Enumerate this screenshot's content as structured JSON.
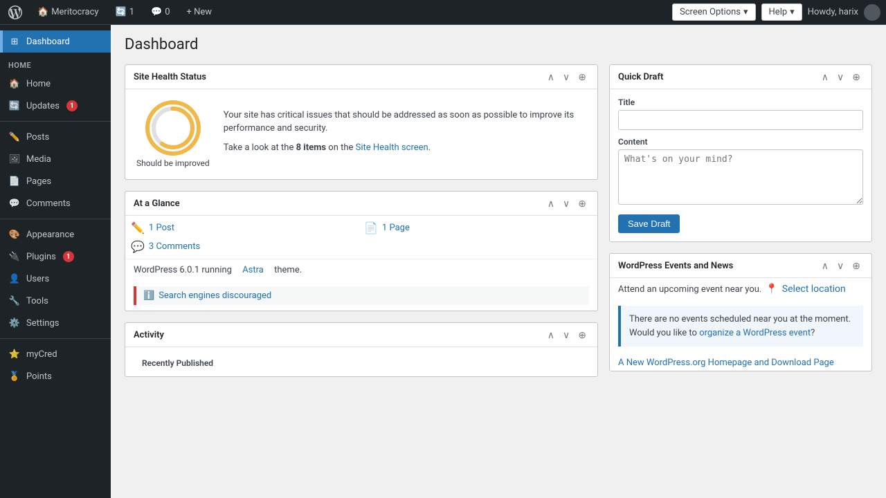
{
  "adminBar": {
    "siteName": "Meritocracy",
    "updates": "1",
    "comments": "0",
    "newLabel": "+ New",
    "howdy": "Howdy, harix",
    "screenOptions": "Screen Options",
    "screenOptionsArrow": "▾",
    "help": "Help",
    "helpArrow": "▾"
  },
  "sidebar": {
    "sectionHome": "Home",
    "home": "Home",
    "updates": "Updates",
    "updatesBadge": "1",
    "posts": "Posts",
    "media": "Media",
    "pages": "Pages",
    "comments": "Comments",
    "appearance": "Appearance",
    "plugins": "Plugins",
    "pluginsBadge": "1",
    "users": "Users",
    "tools": "Tools",
    "settings": "Settings",
    "myCred": "myCred",
    "points": "Points"
  },
  "page": {
    "title": "Dashboard"
  },
  "siteHealth": {
    "title": "Site Health Status",
    "circleLabel": "Should be improved",
    "description": "Your site has critical issues that should be addressed as soon as possible to improve its performance and security.",
    "linkText": "8 items",
    "linkLabel": "Take a look at the",
    "linkSuffix": "on the",
    "screenText": "Site Health screen",
    "fullText": "Take a look at the 8 items on the Site Health screen."
  },
  "atAGlance": {
    "title": "At a Glance",
    "post": "1 Post",
    "page": "1 Page",
    "comments": "3 Comments",
    "wpVersion": "WordPress 6.0.1 running",
    "theme": "Astra",
    "themeSuffix": "theme.",
    "warningText": "Search engines discouraged"
  },
  "activity": {
    "title": "Activity",
    "recentPublished": "Recently Published"
  },
  "quickDraft": {
    "title": "Quick Draft",
    "titleLabel": "Title",
    "contentLabel": "Content",
    "contentPlaceholder": "What's on your mind?",
    "saveDraft": "Save Draft"
  },
  "wpEvents": {
    "title": "WordPress Events and News",
    "intro": "Attend an upcoming event near you.",
    "locationText": "Select location",
    "noticeText": "There are no events scheduled near you at the moment. Would you like to",
    "organizeLinkText": "organize a WordPress event",
    "noticeSuffix": "?",
    "newsTitle": "A New WordPress.org Homepage and Download Page"
  }
}
